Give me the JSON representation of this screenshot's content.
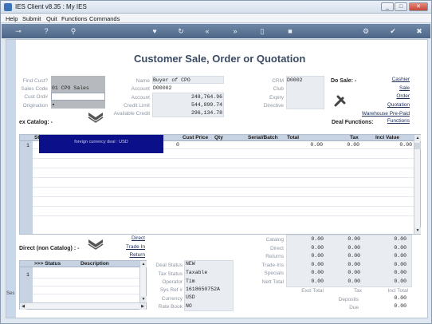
{
  "window": {
    "title": "IES Client v8.35 : My IES",
    "minimize": "_",
    "maximize": "□",
    "close": "✕"
  },
  "menu": [
    "Help",
    "Submit",
    "Quit",
    "Functions",
    "Commands"
  ],
  "toolbar_icons": [
    "key-icon",
    "help-icon",
    "search-icon",
    "heart-icon",
    "refresh-icon",
    "rewind-icon",
    "forward-icon",
    "clipboard-icon",
    "stop-icon",
    "settings-icon",
    "check-icon",
    "close-icon"
  ],
  "form_title": "Customer Sale, Order or Quotation",
  "left_labels": {
    "find_cust": "Find Cust?",
    "sales_code": "Sales Code",
    "cust_ord": "Cust Ord#",
    "origination": "Origination"
  },
  "left_values": {
    "sales_code": "01 CPO Sales",
    "origination": "▾"
  },
  "customer": {
    "name_label": "Name",
    "name": "Buyer of CPO",
    "account_label1": "Account",
    "account_code": "D00002",
    "account_label2": "Account",
    "account_balance": "248,764.96",
    "credit_limit_label": "Credit Limit",
    "credit_limit": "544,899.74",
    "available_credit_label": "Available Credit",
    "available_credit": "296,134.78"
  },
  "crm": {
    "crm_label": "CRM",
    "crm": "D0002",
    "club_label": "Club",
    "expiry_label": "Expiry",
    "directive_label": "Directive"
  },
  "do_sale": {
    "label": "Do Sale: -",
    "links": [
      "Cashier",
      "Sale",
      "Order",
      "Quotation",
      "Warehouse Pre-Paid",
      "Functions"
    ],
    "deal_functions_label": "Deal Functions:"
  },
  "catalog_label": "ex Catalog: -",
  "catalog_grid": {
    "headers": [
      "Stock",
      "Cust Price",
      "Qty",
      "Serial/Batch",
      "Total",
      "Tax",
      "Incl Value"
    ],
    "row_number": "1",
    "row_fragment": "0",
    "total": "0.00",
    "tax": "0.00",
    "incl": "0.00",
    "tooltip": "foreign currency deal : USD"
  },
  "direct_label": "Direct (non Catalog) : -",
  "direct_links": [
    "Direct",
    "Trade In",
    "Return"
  ],
  "direct_grid": {
    "headers": [
      ">>> Status",
      "Description"
    ],
    "row_number": "1"
  },
  "deal": {
    "deal_status_label": "Deal Status",
    "deal_status": "NEW",
    "tax_status_label": "Tax Status",
    "tax_status": "Taxable",
    "operator_label": "Operator",
    "operator": "Tim",
    "sys_ref_label": "Sys Ref #",
    "sys_ref": "1618650752A",
    "currency_label": "Currency",
    "currency": "USD",
    "rate_book_label": "Rate Book",
    "rate_book": "NO"
  },
  "totals": {
    "rows": [
      {
        "label": "Catalog",
        "a": "0.00",
        "b": "0.00",
        "c": "0.00"
      },
      {
        "label": "Direct",
        "a": "0.00",
        "b": "0.00",
        "c": "0.00"
      },
      {
        "label": "Returns",
        "a": "0.00",
        "b": "0.00",
        "c": "0.00"
      },
      {
        "label": "Trade-Ins",
        "a": "0.00",
        "b": "0.00",
        "c": "0.00"
      },
      {
        "label": "Specials",
        "a": "0.00",
        "b": "0.00",
        "c": "0.00"
      },
      {
        "label": "Nett Total",
        "a": "0.00",
        "b": "0.00",
        "c": "0.00"
      }
    ],
    "excl_total_label": "Excl Total",
    "tax_label": "Tax",
    "incl_total_label": "Incl Total",
    "deposits_label": "Deposits",
    "deposits": "0.00",
    "due_label": "Due",
    "due": "0.00"
  },
  "side_fragment": "Ses",
  "colors": {
    "toolbar": "#5a7394",
    "tooltip": "#0b0f8a",
    "title": "#3a4a63"
  }
}
